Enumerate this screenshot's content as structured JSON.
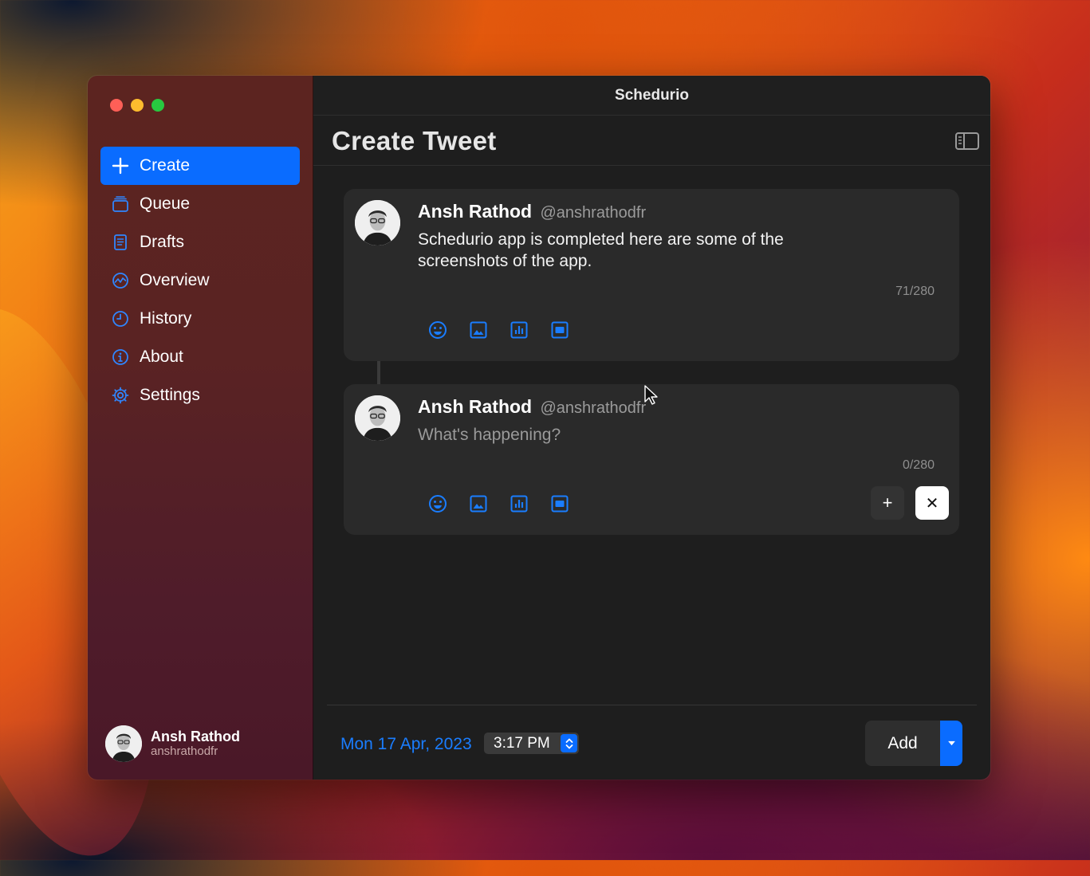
{
  "window": {
    "title": "Schedurio"
  },
  "sidebar": {
    "items": [
      {
        "label": "Create",
        "icon": "plus-icon",
        "active": true
      },
      {
        "label": "Queue",
        "icon": "stack-icon",
        "active": false
      },
      {
        "label": "Drafts",
        "icon": "document-icon",
        "active": false
      },
      {
        "label": "Overview",
        "icon": "chart-wave-icon",
        "active": false
      },
      {
        "label": "History",
        "icon": "clock-icon",
        "active": false
      },
      {
        "label": "About",
        "icon": "info-icon",
        "active": false
      },
      {
        "label": "Settings",
        "icon": "gear-icon",
        "active": false
      }
    ],
    "user": {
      "name": "Ansh Rathod",
      "handle": "anshrathodfr"
    }
  },
  "page": {
    "title": "Create Tweet"
  },
  "tweets": [
    {
      "author": "Ansh Rathod",
      "handle": "@anshrathodfr",
      "text": "Schedurio app is completed here are some of the screenshots of the app.",
      "counter": "71/280"
    },
    {
      "author": "Ansh Rathod",
      "handle": "@anshrathodfr",
      "placeholder": "What's happening?",
      "counter": "0/280",
      "add_label": "+",
      "remove_label": "✕"
    }
  ],
  "footer": {
    "date": "Mon 17 Apr, 2023",
    "time": "3:17 PM",
    "add_label": "Add"
  },
  "colors": {
    "accent": "#0a6cff",
    "link": "#1a7dff"
  }
}
